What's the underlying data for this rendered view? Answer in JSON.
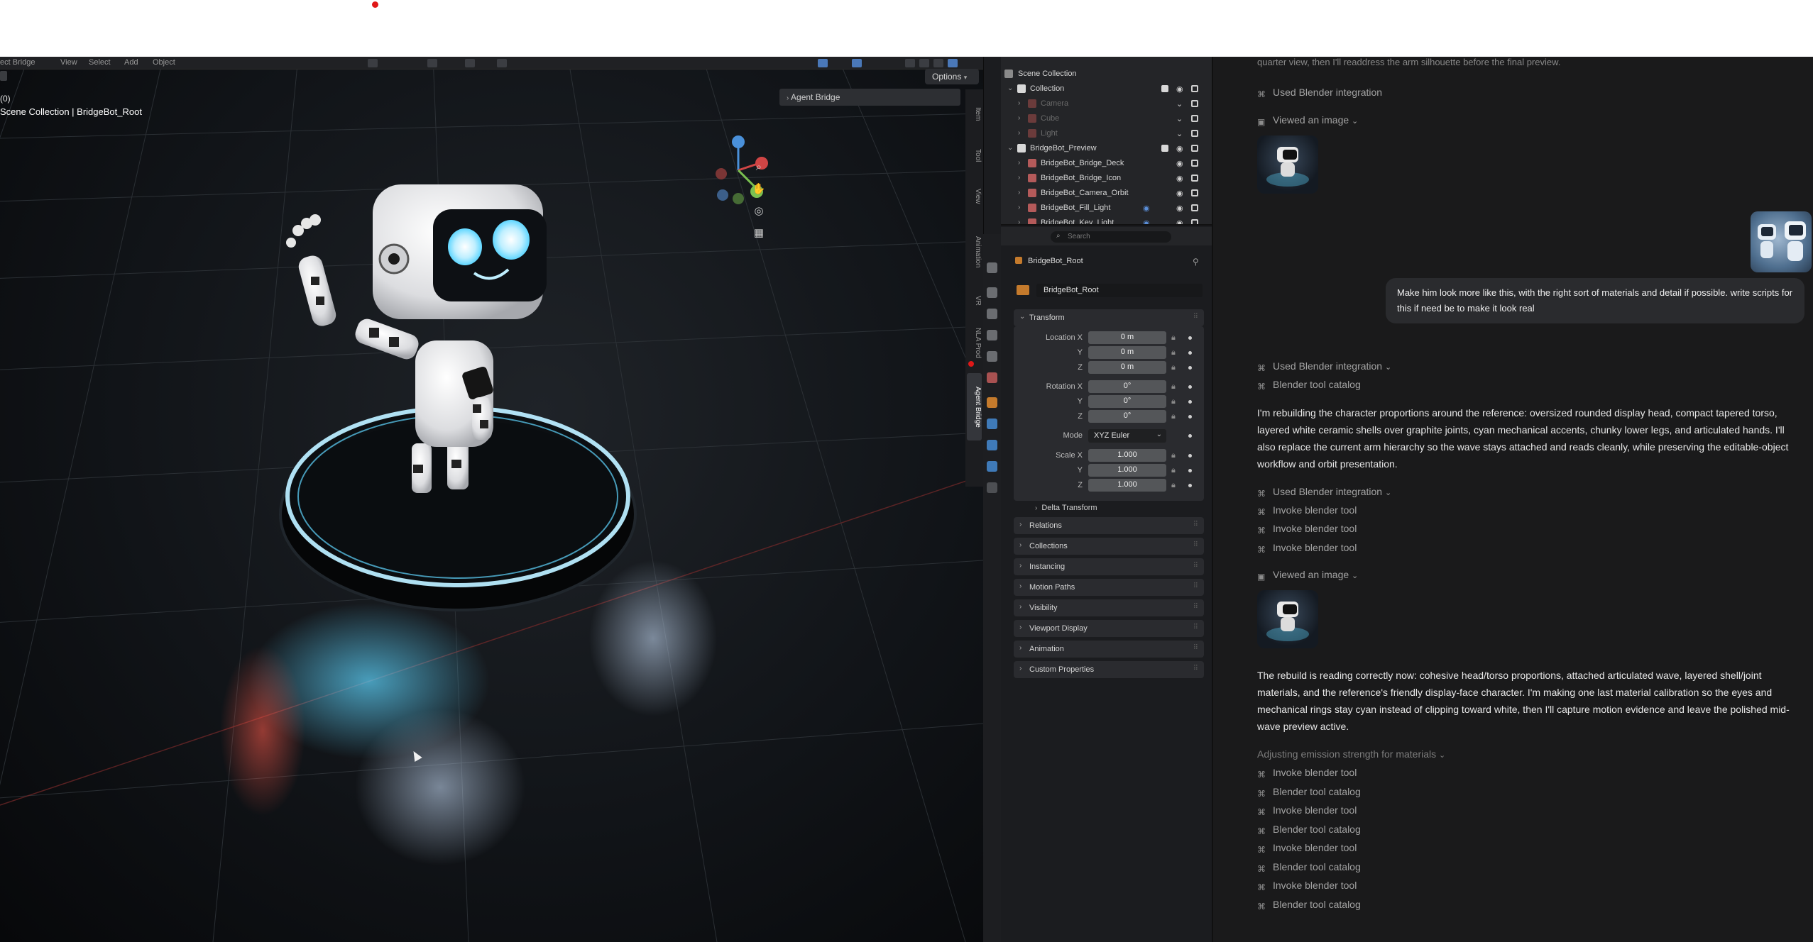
{
  "viewport": {
    "menus": [
      "ect Bridge",
      "View",
      "Select",
      "Add",
      "Object"
    ],
    "frame_label": "(0)",
    "scene_path": "Scene Collection | BridgeBot_Root",
    "options_label": "Options",
    "sidebar_panel_title": "Agent Bridge",
    "sidebar_tabs": [
      "Item",
      "Tool",
      "View",
      "Animation",
      "VR",
      "NLA Prod",
      "Agent Bridge"
    ],
    "active_tab": "Agent Bridge"
  },
  "outliner": {
    "root": "Scene Collection",
    "rows": [
      {
        "label": "Collection",
        "depth": 1,
        "kind": "collection",
        "dim": false
      },
      {
        "label": "Camera",
        "depth": 2,
        "kind": "camera",
        "dim": true
      },
      {
        "label": "Cube",
        "depth": 2,
        "kind": "mesh",
        "dim": true
      },
      {
        "label": "Light",
        "depth": 2,
        "kind": "light",
        "dim": true
      },
      {
        "label": "BridgeBot_Preview",
        "depth": 1,
        "kind": "collection",
        "dim": false
      },
      {
        "label": "BridgeBot_Bridge_Deck",
        "depth": 2,
        "kind": "curve",
        "dim": false
      },
      {
        "label": "BridgeBot_Bridge_Icon",
        "depth": 2,
        "kind": "curve",
        "dim": false
      },
      {
        "label": "BridgeBot_Camera_Orbit",
        "depth": 2,
        "kind": "empty",
        "dim": false
      },
      {
        "label": "BridgeBot_Fill_Light",
        "depth": 2,
        "kind": "light",
        "dim": false
      },
      {
        "label": "BridgeBot_Key_Light",
        "depth": 2,
        "kind": "light",
        "dim": false
      }
    ]
  },
  "properties": {
    "search_placeholder": "Search",
    "object_name": "BridgeBot_Root",
    "object_field": "BridgeBot_Root",
    "transform_title": "Transform",
    "location_label": "Location X",
    "rotation_label": "Rotation X",
    "scale_label": "Scale X",
    "axis_y": "Y",
    "axis_z": "Z",
    "location": [
      "0 m",
      "0 m",
      "0 m"
    ],
    "rotation": [
      "0°",
      "0°",
      "0°"
    ],
    "mode_label": "Mode",
    "mode_value": "XYZ Euler",
    "scale": [
      "1.000",
      "1.000",
      "1.000"
    ],
    "delta_transform": "Delta Transform",
    "sections": [
      "Relations",
      "Collections",
      "Instancing",
      "Motion Paths",
      "Visibility",
      "Viewport Display",
      "Animation",
      "Custom Properties"
    ]
  },
  "chat": {
    "top_cutoff": "quarter view, then I'll readdress the arm silhouette before the final preview.",
    "used_blender_1": "Used Blender integration",
    "viewed_image_1": "Viewed an image",
    "user_message": "Make him look more like this, with the right sort of materials and detail if possible. write scripts for this if need be to make it look real",
    "used_blender_2": "Used Blender integration",
    "tool_catalog_1": "Blender tool catalog",
    "assistant_1": "I'm rebuilding the character proportions around the reference: oversized rounded display head, compact tapered torso, layered white ceramic shells over graphite joints, cyan mechanical accents, chunky lower legs, and articulated hands. I'll also replace the current arm hierarchy so the wave stays attached and reads cleanly, while preserving the editable-object workflow and orbit presentation.",
    "used_blender_3": "Used Blender integration",
    "invoke_1": "Invoke blender tool",
    "invoke_2": "Invoke blender tool",
    "invoke_3": "Invoke blender tool",
    "viewed_image_2": "Viewed an image",
    "assistant_2": "The rebuild is reading correctly now: cohesive head/torso proportions, attached articulated wave, layered shell/joint materials, and the reference's friendly display-face character. I'm making one last material calibration so the eyes and mechanical rings stay cyan instead of clipping toward white, then I'll capture motion evidence and leave the polished mid-wave preview active.",
    "status_line": "Adjusting emission strength for materials",
    "final_tools": [
      "Invoke blender tool",
      "Blender tool catalog",
      "Invoke blender tool",
      "Blender tool catalog",
      "Invoke blender tool",
      "Blender tool catalog",
      "Invoke blender tool",
      "Blender tool catalog"
    ]
  },
  "colors": {
    "accent_cyan": "#5fd6ff",
    "chat_bg": "#1a1a1b",
    "blender_panel": "#2a2b2f",
    "record_red": "#e01818"
  }
}
